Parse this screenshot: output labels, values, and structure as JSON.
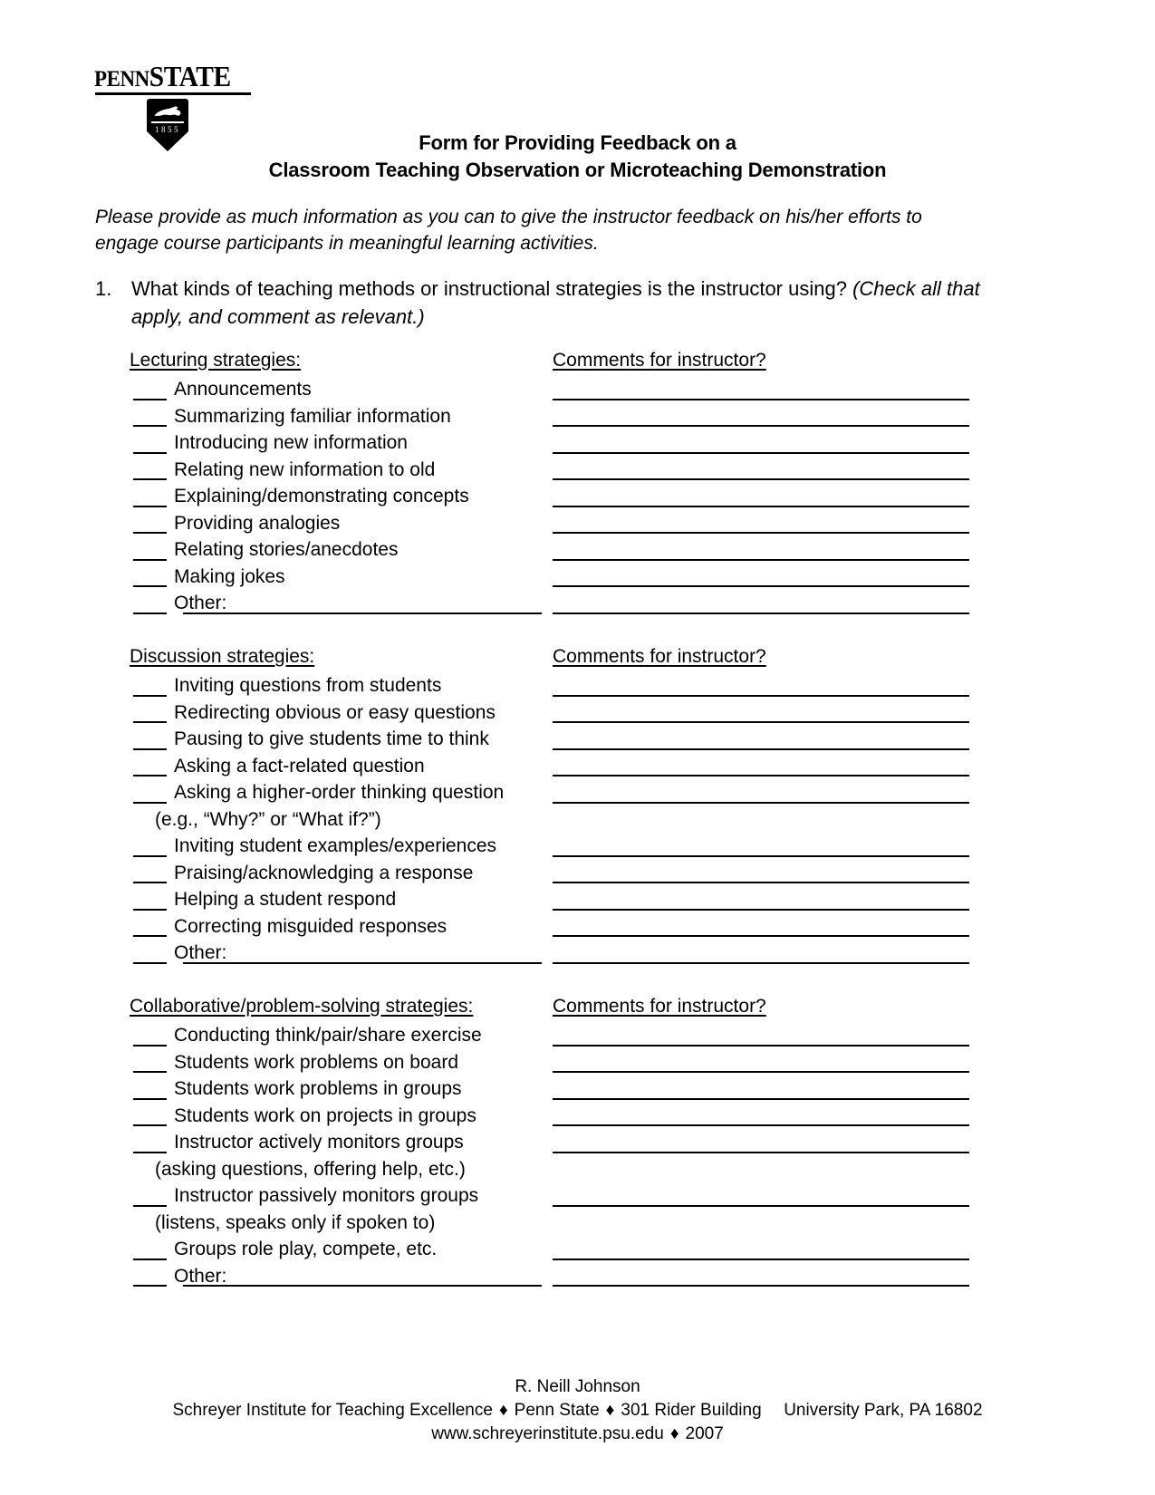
{
  "logo": {
    "wordmark_penn": "PENN",
    "wordmark_state": "STATE",
    "shield_year": "1855",
    "shield_emblem": "nittany-lion"
  },
  "title": {
    "line1": "Form for Providing Feedback on a",
    "line2": "Classroom Teaching Observation or Microteaching Demonstration"
  },
  "intro": "Please provide as much information as you can to give the instructor feedback on his/her efforts to engage course participants in meaningful learning activities.",
  "question": {
    "number": "1.",
    "text": "What kinds of teaching methods or instructional strategies is the instructor using?  ",
    "parenthetical": "(Check all that apply, and comment as relevant.)"
  },
  "comments_header": "Comments for instructor?",
  "other_label": "Other:",
  "sections": [
    {
      "heading": "Lecturing strategies:",
      "items": [
        {
          "label": "Announcements",
          "blank": true,
          "comment_line": true
        },
        {
          "label": "Summarizing familiar information",
          "blank": true,
          "comment_line": true
        },
        {
          "label": "Introducing new information",
          "blank": true,
          "comment_line": true
        },
        {
          "label": "Relating new information to old",
          "blank": true,
          "comment_line": true
        },
        {
          "label": "Explaining/demonstrating concepts",
          "blank": true,
          "comment_line": true
        },
        {
          "label": "Providing analogies",
          "blank": true,
          "comment_line": true
        },
        {
          "label": "Relating stories/anecdotes",
          "blank": true,
          "comment_line": true
        },
        {
          "label": "Making jokes",
          "blank": true,
          "comment_line": true
        },
        {
          "label": "Other:",
          "blank": true,
          "comment_line": true,
          "write_in": true
        }
      ]
    },
    {
      "heading": "Discussion strategies:",
      "items": [
        {
          "label": "Inviting questions from students",
          "blank": true,
          "comment_line": true
        },
        {
          "label": "Redirecting obvious or easy questions",
          "blank": true,
          "comment_line": true
        },
        {
          "label": "Pausing to give students time to think",
          "blank": true,
          "comment_line": true
        },
        {
          "label": "Asking a fact-related question",
          "blank": true,
          "comment_line": true
        },
        {
          "label": "Asking a higher-order thinking question",
          "blank": true,
          "comment_line": true
        },
        {
          "label": "(e.g., “Why?” or “What if?”)",
          "blank": false,
          "comment_line": false,
          "continuation": true
        },
        {
          "label": "Inviting student examples/experiences",
          "blank": true,
          "comment_line": true
        },
        {
          "label": "Praising/acknowledging a response",
          "blank": true,
          "comment_line": true
        },
        {
          "label": "Helping a student respond",
          "blank": true,
          "comment_line": true
        },
        {
          "label": "Correcting misguided responses",
          "blank": true,
          "comment_line": true
        },
        {
          "label": "Other:",
          "blank": true,
          "comment_line": true,
          "write_in": true
        }
      ]
    },
    {
      "heading": "Collaborative/problem-solving strategies:",
      "items": [
        {
          "label": "Conducting think/pair/share exercise",
          "blank": true,
          "comment_line": true
        },
        {
          "label": "Students work problems on board",
          "blank": true,
          "comment_line": true
        },
        {
          "label": "Students work problems in groups",
          "blank": true,
          "comment_line": true
        },
        {
          "label": "Students work on projects in groups",
          "blank": true,
          "comment_line": true
        },
        {
          "label": "Instructor actively monitors groups",
          "blank": true,
          "comment_line": true
        },
        {
          "label": "(asking questions, offering help, etc.)",
          "blank": false,
          "comment_line": false,
          "continuation": true
        },
        {
          "label": "Instructor passively monitors groups",
          "blank": true,
          "comment_line": true
        },
        {
          "label": "(listens, speaks only if spoken to)",
          "blank": false,
          "comment_line": false,
          "continuation": true
        },
        {
          "label": "Groups role play, compete, etc.",
          "blank": true,
          "comment_line": true
        },
        {
          "label": "Other:",
          "blank": true,
          "comment_line": true,
          "write_in": true
        }
      ]
    }
  ],
  "footer": {
    "author": "R. Neill Johnson",
    "org": "Schreyer Institute for Teaching Excellence",
    "affiliation": "Penn State",
    "building": "301 Rider Building",
    "city": "University Park, PA 16802",
    "website": "www.schreyerinstitute.psu.edu",
    "year": "2007",
    "separator": "♦"
  }
}
